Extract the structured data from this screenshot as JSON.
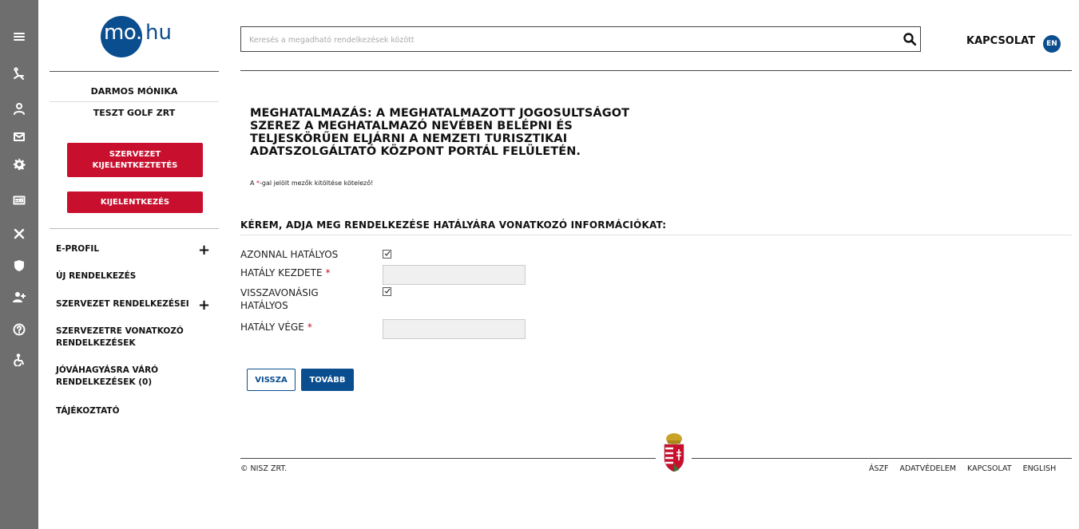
{
  "rail": {
    "icons": [
      "menu-icon",
      "sun-lounger-icon",
      "user-icon",
      "mail-icon",
      "gear-icon",
      "id-card-icon",
      "tools-icon",
      "shield-icon",
      "user-plus-icon",
      "help-icon",
      "accessibility-icon"
    ]
  },
  "logo": {
    "mo": "mo",
    "dot": ".",
    "hu": "hu"
  },
  "user": {
    "name": "DARMOS MÓNIKA",
    "org": "TESZT GOLF ZRT"
  },
  "buttons": {
    "org_logout": "SZERVEZET KIJELENTKEZTETÉS",
    "logout": "KIJELENTKEZÉS",
    "back": "VISSZA",
    "next": "TOVÁBB"
  },
  "nav": {
    "items": [
      {
        "label": "E-PROFIL",
        "expandable": true,
        "plus": "+"
      },
      {
        "label": "ÚJ RENDELKEZÉS",
        "expandable": false
      },
      {
        "label": "SZERVEZET RENDELKEZÉSEI",
        "expandable": true,
        "plus": "+"
      },
      {
        "label": "SZERVEZETRE VONATKOZÓ RENDELKEZÉSEK",
        "expandable": false
      },
      {
        "label": "JÓVÁHAGYÁSRA VÁRÓ RENDELKEZÉSEK (0)",
        "expandable": false
      },
      {
        "label": "TÁJÉKOZTATÓ",
        "expandable": false
      }
    ]
  },
  "search": {
    "placeholder": "Keresés a megadható rendelkezések között",
    "value": ""
  },
  "header": {
    "contact": "KAPCSOLAT",
    "lang": "EN"
  },
  "main": {
    "title": "MEGHATALMAZÁS: A MEGHATALMAZOTT JOGOSULTSÁGOT SZEREZ A MEGHATALMAZÓ NEVÉBEN BELÉPNI ÉS TELJESKÖRŰEN ELJÁRNI A NEMZETI TURISZTIKAI ADATSZOLGÁLTATÓ KÖZPONT PORTÁL FELÜLETÉN.",
    "note_prefix": "A ",
    "note_star": "*",
    "note_suffix": "-gal jelölt mezők kitöltése kötelező!",
    "section_title": "KÉREM, ADJA MEG RENDELKEZÉSE HATÁLYÁRA VONATKOZÓ INFORMÁCIÓKAT:",
    "fields": {
      "immediate_label": "AZONNAL HATÁLYOS",
      "immediate_checked": true,
      "start_label": "HATÁLY KEZDETE",
      "start_value": "",
      "until_revoked_label": "VISSZAVONÁSIG HATÁLYOS",
      "until_revoked_checked": true,
      "end_label": "HATÁLY VÉGE",
      "end_value": "",
      "required_mark": "*"
    }
  },
  "footer": {
    "copyright": "© NISZ ZRT.",
    "links": [
      "ÁSZF",
      "ADATVÉDELEM",
      "KAPCSOLAT",
      "ENGLISH"
    ]
  },
  "colors": {
    "brand_blue": "#0b4e8f",
    "brand_red": "#c8102e",
    "rail_gray": "#6e6e6e"
  }
}
